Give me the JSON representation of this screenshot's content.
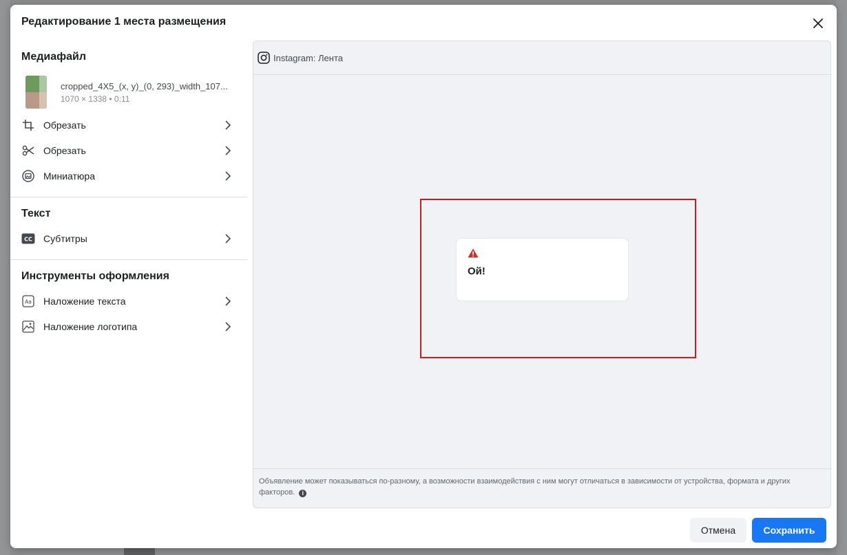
{
  "modal": {
    "title": "Редактирование 1 места размещения"
  },
  "left_panel": {
    "media_section": {
      "title": "Медиафайл",
      "file_name": "cropped_4X5_(x, y)_(0, 293)_width_107...",
      "file_meta": "1070 × 1338 • 0:11",
      "items": [
        {
          "label": "Обрезать",
          "icon": "crop-icon"
        },
        {
          "label": "Обрезать",
          "icon": "scissors-icon"
        },
        {
          "label": "Миниатюра",
          "icon": "thumbnail-icon"
        }
      ]
    },
    "text_section": {
      "title": "Текст",
      "items": [
        {
          "label": "Субтитры",
          "icon": "captions-icon"
        }
      ]
    },
    "tools_section": {
      "title": "Инструменты оформления",
      "items": [
        {
          "label": "Наложение текста",
          "icon": "text-overlay-icon"
        },
        {
          "label": "Наложение логотипа",
          "icon": "image-overlay-icon"
        }
      ]
    }
  },
  "preview": {
    "placement_label": "Instagram: Лента",
    "error_message": "Ой!",
    "footer_note": "Объявление может показываться по-разному, а возможности взаимодействия с ним могут отличаться в зависимости от устройства, формата и других факторов."
  },
  "footer": {
    "cancel_label": "Отмена",
    "save_label": "Сохранить"
  },
  "colors": {
    "accent": "#1877f2",
    "highlight_frame": "#cc1b1b",
    "warning": "#cc2f1f"
  }
}
